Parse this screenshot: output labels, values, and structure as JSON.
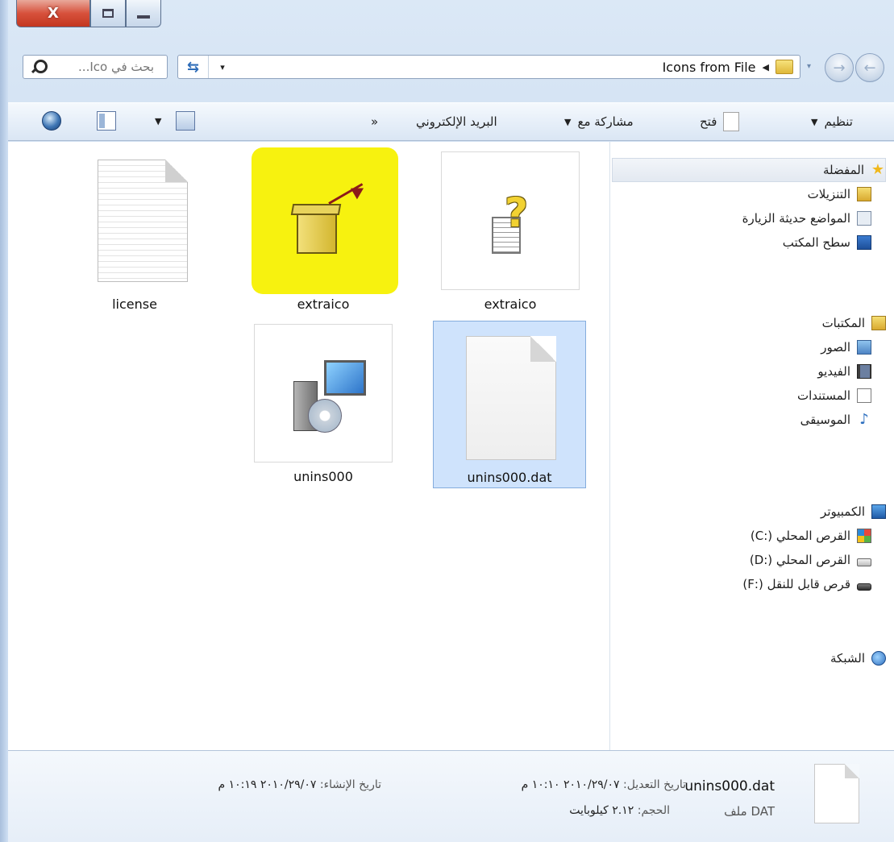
{
  "window": {
    "close_glyph": "X",
    "folder": "Icons from File"
  },
  "search": {
    "placeholder": "بحث في Ico..."
  },
  "address": {
    "path_separator": "◀",
    "dropdown": "▾"
  },
  "toolbar": {
    "organize": "تنظيم",
    "open": "فتح",
    "share_with": "مشاركة مع",
    "email": "البريد الإلكتروني",
    "more": "«"
  },
  "files": [
    {
      "label": "extraico",
      "type": "help-file"
    },
    {
      "label": "extraico",
      "type": "application-highlighted"
    },
    {
      "label": "license",
      "type": "text-document"
    },
    {
      "label": "unins000.dat",
      "type": "dat-file",
      "selected": true
    },
    {
      "label": "unins000",
      "type": "uninstaller"
    }
  ],
  "nav": {
    "favorites": {
      "label": "المفضلة",
      "items": [
        "التنزيلات",
        "المواضع حديثة الزيارة",
        "سطح المكتب"
      ]
    },
    "libraries": {
      "label": "المكتبات",
      "items": [
        "الصور",
        "الفيديو",
        "المستندات",
        "الموسيقى"
      ]
    },
    "computer": {
      "label": "الكمبيوتر",
      "items": [
        "القرص المحلي (:C)",
        "القرص المحلي (:D)",
        "قرص قابل للنقل (:F)"
      ]
    },
    "network": {
      "label": "الشبكة"
    }
  },
  "details": {
    "filename": "unins000.dat",
    "filetype": "ملف DAT",
    "modified_label": "تاريخ التعديل:",
    "modified_value": "٢٠١٠/٢٩/٠٧ ١٠:١٠ م",
    "size_label": "الحجم:",
    "size_value": "٢.١٢ كيلوبايت",
    "created_label": "تاريخ الإنشاء:",
    "created_value": "٢٠١٠/٢٩/٠٧ ١٠:١٩ م"
  },
  "colors": {
    "highlight": "#f7f20f",
    "selection": "#cfe3fc",
    "frame": "#c7d9ee",
    "close_button": "#d7513c"
  }
}
